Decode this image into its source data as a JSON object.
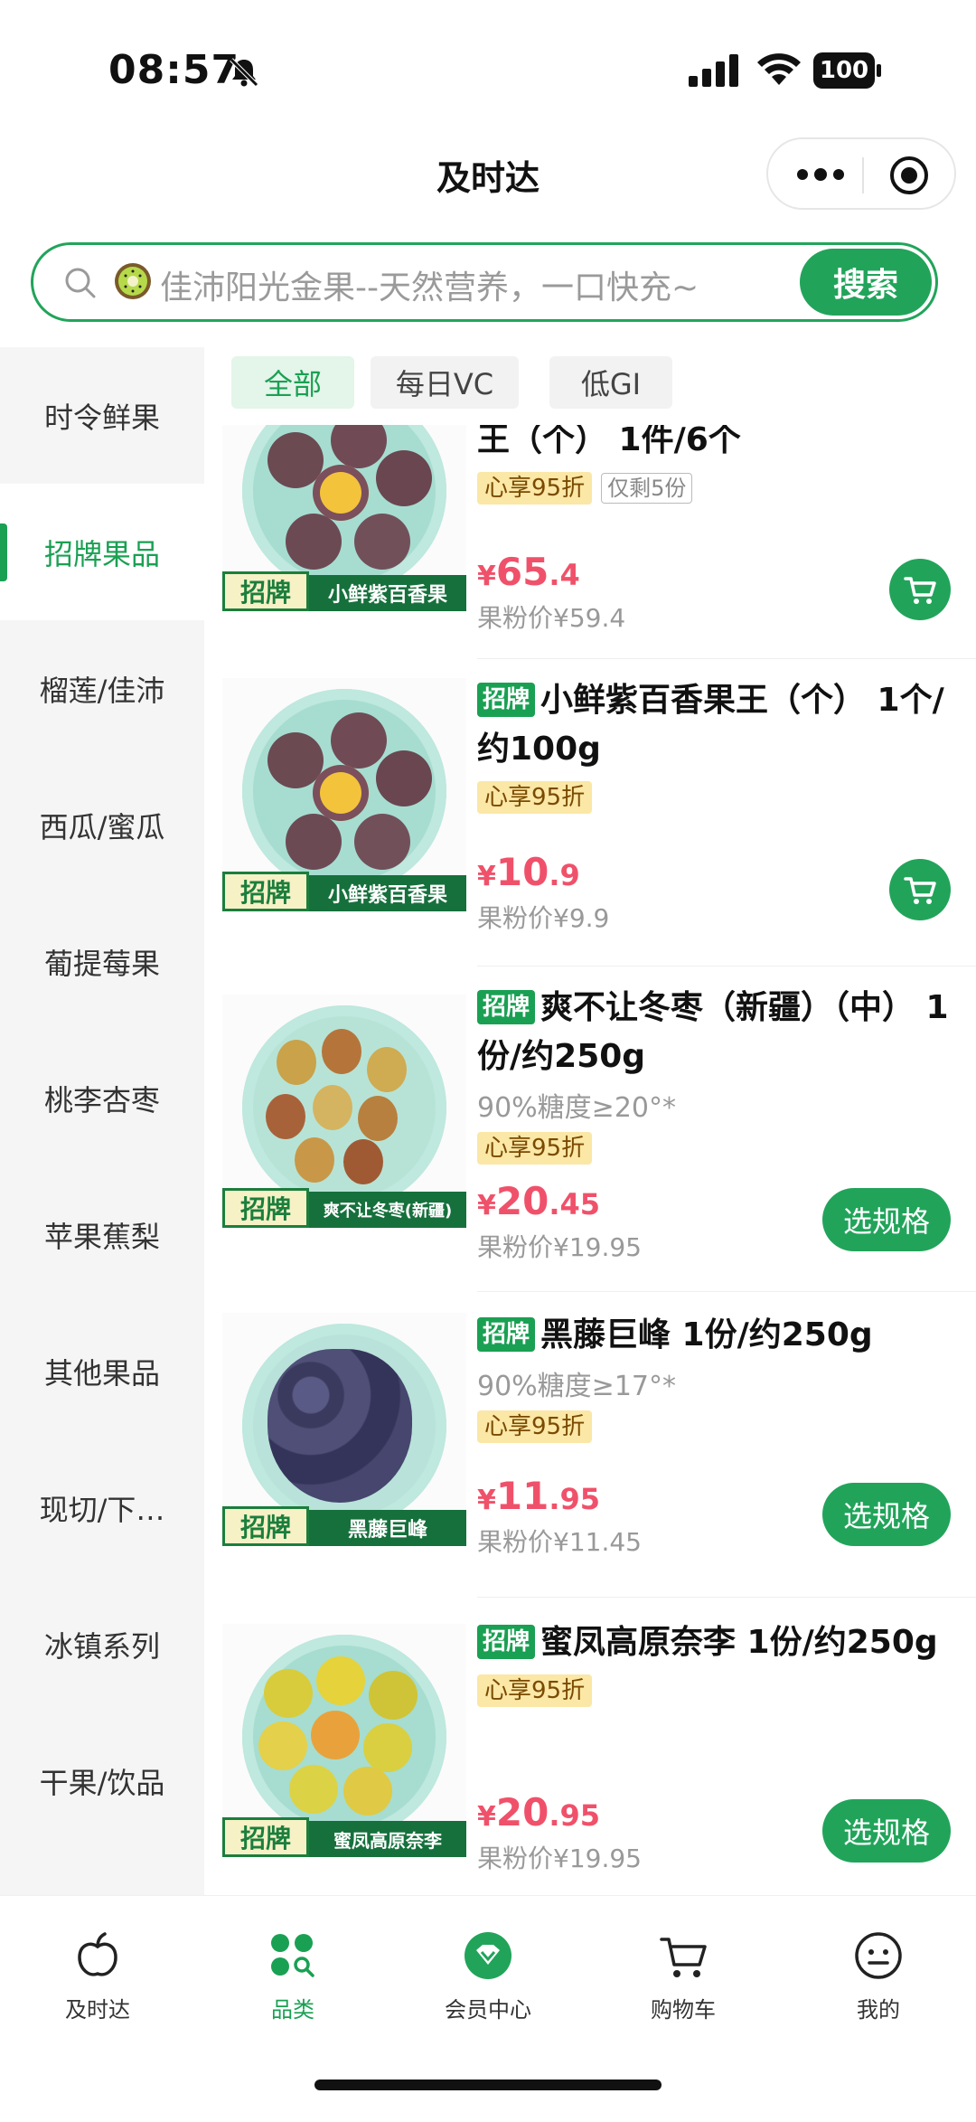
{
  "status_bar": {
    "time": "08:57",
    "battery": "100"
  },
  "nav": {
    "title": "及时达"
  },
  "search": {
    "placeholder": "佳沛阳光金果--天然营养，一口快充~",
    "button": "搜索"
  },
  "sidebar": {
    "items": [
      {
        "label": "时令鲜果",
        "active": false
      },
      {
        "label": "招牌果品",
        "active": true
      },
      {
        "label": "榴莲/佳沛",
        "active": false
      },
      {
        "label": "西瓜/蜜瓜",
        "active": false
      },
      {
        "label": "葡提莓果",
        "active": false
      },
      {
        "label": "桃李杏枣",
        "active": false
      },
      {
        "label": "苹果蕉梨",
        "active": false
      },
      {
        "label": "其他果品",
        "active": false
      },
      {
        "label": "现切/下…",
        "active": false
      },
      {
        "label": "冰镇系列",
        "active": false
      },
      {
        "label": "干果/饮品",
        "active": false
      }
    ]
  },
  "filters": [
    {
      "label": "全部",
      "active": true
    },
    {
      "label": "每日VC",
      "active": false
    },
    {
      "label": "低GI",
      "active": false
    }
  ],
  "products": [
    {
      "badge": "",
      "title": "王（个） 1件/6个",
      "subtitle": "",
      "discount": "心享95折",
      "stock": "仅剩5份",
      "price_int": "65",
      "price_dec": ".4",
      "fan_price": "果粉价¥59.4",
      "action": "cart",
      "action_label": "",
      "img_tag": "招牌",
      "img_name": "小鲜紫百香果",
      "fruit": "passion"
    },
    {
      "badge": "招牌",
      "title": "小鲜紫百香果王（个） 1个/约100g",
      "subtitle": "",
      "discount": "心享95折",
      "stock": "",
      "price_int": "10",
      "price_dec": ".9",
      "fan_price": "果粉价¥9.9",
      "action": "cart",
      "action_label": "",
      "img_tag": "招牌",
      "img_name": "小鲜紫百香果",
      "fruit": "passion"
    },
    {
      "badge": "招牌",
      "title": "爽不让冬枣（新疆）（中） 1份/约250g",
      "subtitle": "90%糖度≥20°*",
      "discount": "心享95折",
      "stock": "",
      "price_int": "20",
      "price_dec": ".45",
      "fan_price": "果粉价¥19.95",
      "action": "spec",
      "action_label": "选规格",
      "img_tag": "招牌",
      "img_name": "爽不让冬枣(新疆)",
      "fruit": "jujube"
    },
    {
      "badge": "招牌",
      "title": "黑藤巨峰 1份/约250g",
      "subtitle": "90%糖度≥17°*",
      "discount": "心享95折",
      "stock": "",
      "price_int": "11",
      "price_dec": ".95",
      "fan_price": "果粉价¥11.45",
      "action": "spec",
      "action_label": "选规格",
      "img_tag": "招牌",
      "img_name": "黑藤巨峰",
      "fruit": "grape"
    },
    {
      "badge": "招牌",
      "title": "蜜凤高原奈李 1份/约250g",
      "subtitle": "",
      "discount": "心享95折",
      "stock": "",
      "price_int": "20",
      "price_dec": ".95",
      "fan_price": "果粉价¥19.95",
      "action": "spec",
      "action_label": "选规格",
      "img_tag": "招牌",
      "img_name": "蜜凤高原奈李",
      "fruit": "plum"
    }
  ],
  "tabbar": [
    {
      "label": "及时达",
      "icon": "apple-icon",
      "active": false
    },
    {
      "label": "品类",
      "icon": "category-icon",
      "active": true
    },
    {
      "label": "会员中心",
      "icon": "member-icon",
      "active": false
    },
    {
      "label": "购物车",
      "icon": "cart-icon",
      "active": false
    },
    {
      "label": "我的",
      "icon": "profile-icon",
      "active": false
    }
  ],
  "colors": {
    "brand_green": "#21a45a",
    "price_red": "#f0516a",
    "discount_bg": "#fbe7a6"
  }
}
